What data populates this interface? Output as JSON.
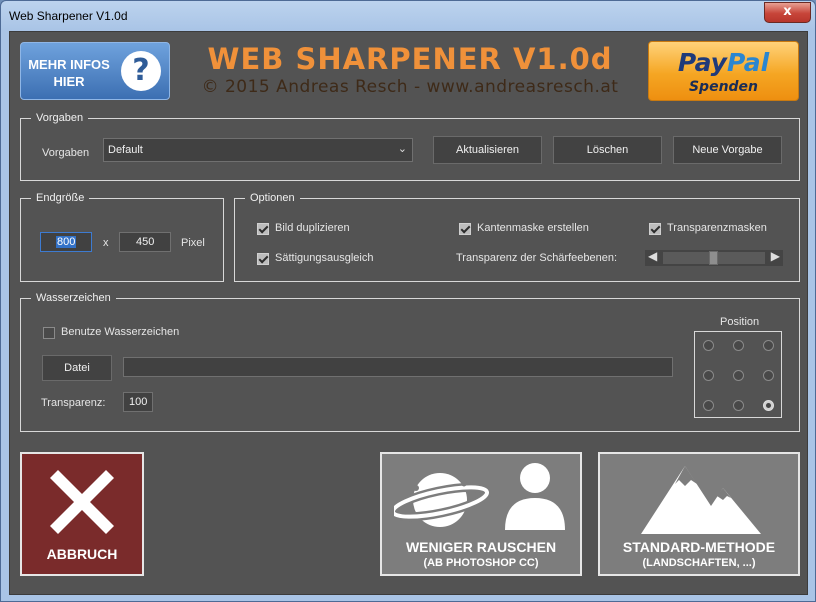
{
  "window": {
    "title": "Web Sharpener V1.0d",
    "close_glyph": "x"
  },
  "header": {
    "info_button": {
      "line1": "MEHR INFOS",
      "line2": "HIER",
      "icon": "question-icon"
    },
    "app_title": "WEB SHARPENER V1.0d",
    "app_subtitle": "© 2015 Andreas Resch - www.andreasresch.at",
    "paypal": {
      "brand_part1": "Pay",
      "brand_part2": "Pal",
      "caption": "Spenden"
    }
  },
  "vorgaben": {
    "group_label": "Vorgaben",
    "field_label": "Vorgaben",
    "selected": "Default",
    "buttons": {
      "update": "Aktualisieren",
      "delete": "Löschen",
      "new": "Neue Vorgabe"
    }
  },
  "endgroesse": {
    "group_label": "Endgröße",
    "width": "800",
    "separator": "x",
    "height": "450",
    "unit": "Pixel"
  },
  "optionen": {
    "group_label": "Optionen",
    "checkboxes": [
      {
        "label": "Bild duplizieren",
        "checked": true
      },
      {
        "label": "Kantenmaske erstellen",
        "checked": true
      },
      {
        "label": "Transparenzmasken",
        "checked": true
      },
      {
        "label": "Sättigungsausgleich",
        "checked": true
      }
    ],
    "transparency_label": "Transparenz der Schärfeebenen:",
    "slider_value": 0.5
  },
  "wasserzeichen": {
    "group_label": "Wasserzeichen",
    "use_label": "Benutze Wasserzeichen",
    "use_checked": false,
    "file_button": "Datei",
    "file_path": "",
    "transparency_label": "Transparenz:",
    "transparency_value": "100",
    "position_label": "Position",
    "position_selected": 8
  },
  "actions": {
    "cancel": {
      "label": "ABBRUCH",
      "color": "#7a2b2b"
    },
    "noise": {
      "line1": "WENIGER RAUSCHEN",
      "line2": "(AB PHOTOSHOP CC)",
      "color": "#7d7d7d"
    },
    "standard": {
      "line1": "STANDARD-METHODE",
      "line2": "(LANDSCHAFTEN, ...)",
      "color": "#7d7d7d"
    }
  },
  "colors": {
    "accent_orange": "#f0913a",
    "subtitle_brown": "#3e2a18",
    "info_blue": "#4a7fc4",
    "paypal_orange": "#f5a623"
  }
}
